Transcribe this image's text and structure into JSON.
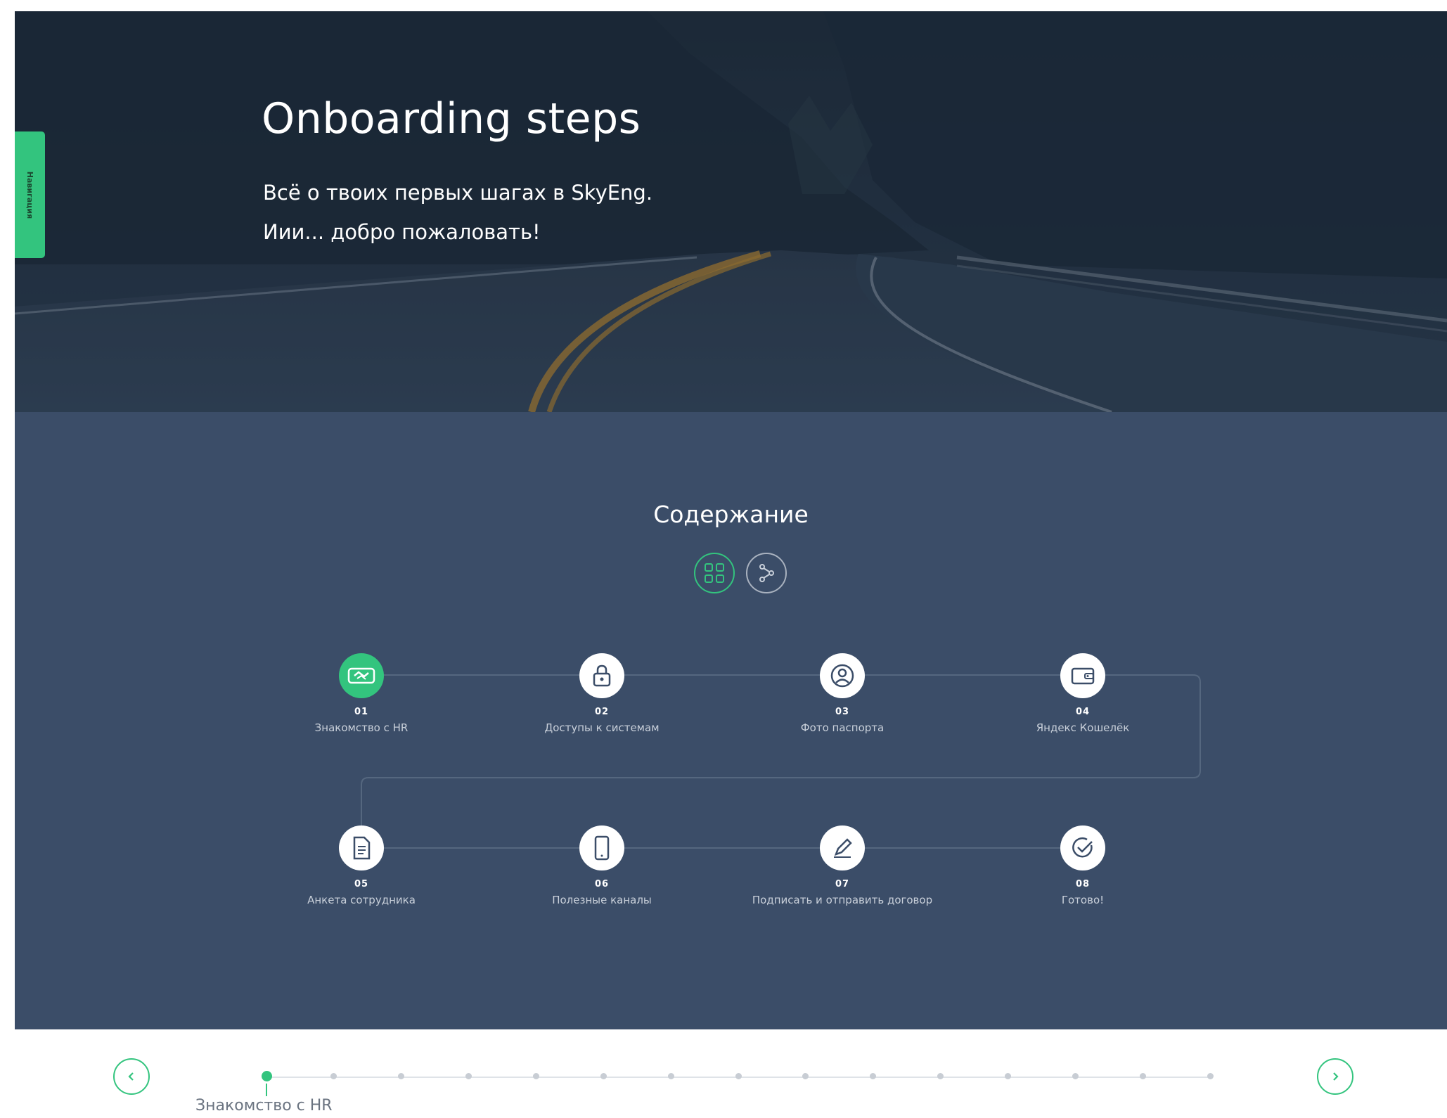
{
  "hero": {
    "title": "Onboarding steps",
    "subtitle_line1": "Всё о твоих первых шагах в SkyEng.",
    "subtitle_line2": "Иии... добро пожаловать!",
    "side_tab_label": "Навигация"
  },
  "contents": {
    "title": "Содержание",
    "view_buttons": [
      {
        "icon": "grid-icon",
        "active": true
      },
      {
        "icon": "flow-icon",
        "active": false
      }
    ],
    "steps": [
      {
        "num": "01",
        "label": "Знакомство с HR",
        "icon": "handshake-icon",
        "active": true
      },
      {
        "num": "02",
        "label": "Доступы к системам",
        "icon": "lock-icon",
        "active": false
      },
      {
        "num": "03",
        "label": "Фото паспорта",
        "icon": "user-circle-icon",
        "active": false
      },
      {
        "num": "04",
        "label": "Яндекс Кошелёк",
        "icon": "wallet-icon",
        "active": false
      },
      {
        "num": "05",
        "label": "Анкета сотрудника",
        "icon": "document-icon",
        "active": false
      },
      {
        "num": "06",
        "label": "Полезные каналы",
        "icon": "phone-icon",
        "active": false
      },
      {
        "num": "07",
        "label": "Подписать и отправить договор",
        "icon": "pen-icon",
        "active": false
      },
      {
        "num": "08",
        "label": "Готово!",
        "icon": "check-circle-icon",
        "active": false
      }
    ]
  },
  "footer": {
    "current_step_label": "Знакомство с HR",
    "total_dots": 15,
    "active_dot": 1
  },
  "colors": {
    "accent": "#33c47e",
    "section_bg": "#3b4d68",
    "hero_bg": "#26364a"
  }
}
